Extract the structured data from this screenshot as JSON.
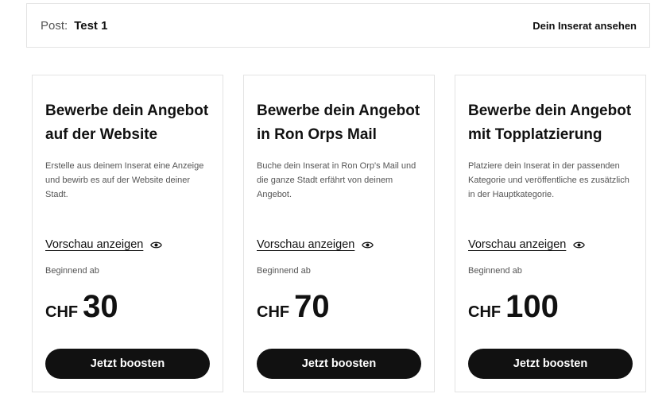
{
  "post": {
    "label": "Post:",
    "title": "Test 1",
    "view_link": "Dein Inserat ansehen"
  },
  "cards": [
    {
      "title_line1": "Bewerbe dein Angebot",
      "title_line2": "auf der Website",
      "description": "Erstelle aus deinem Inserat eine Anzeige und bewirb es auf der Website deiner Stadt.",
      "preview": "Vorschau anzeigen",
      "starting": "Beginnend ab",
      "currency": "CHF",
      "amount": "30",
      "button": "Jetzt boosten"
    },
    {
      "title_line1": "Bewerbe dein Angebot",
      "title_line2": "in Ron Orps Mail",
      "description": "Buche dein Inserat in Ron Orp's Mail und die ganze Stadt erfährt von deinem Angebot.",
      "preview": "Vorschau anzeigen",
      "starting": "Beginnend ab",
      "currency": "CHF",
      "amount": "70",
      "button": "Jetzt boosten"
    },
    {
      "title_line1": "Bewerbe dein Angebot",
      "title_line2": "mit Topplatzierung",
      "description": "Platziere dein Inserat in der passenden Kategorie und veröffentliche es zusätzlich in der Hauptkategorie.",
      "preview": "Vorschau anzeigen",
      "starting": "Beginnend ab",
      "currency": "CHF",
      "amount": "100",
      "button": "Jetzt boosten"
    }
  ],
  "icons": {
    "preview": "eye-icon"
  },
  "colors": {
    "button_bg": "#111111",
    "button_text": "#ffffff",
    "border": "#e3e3e3"
  }
}
